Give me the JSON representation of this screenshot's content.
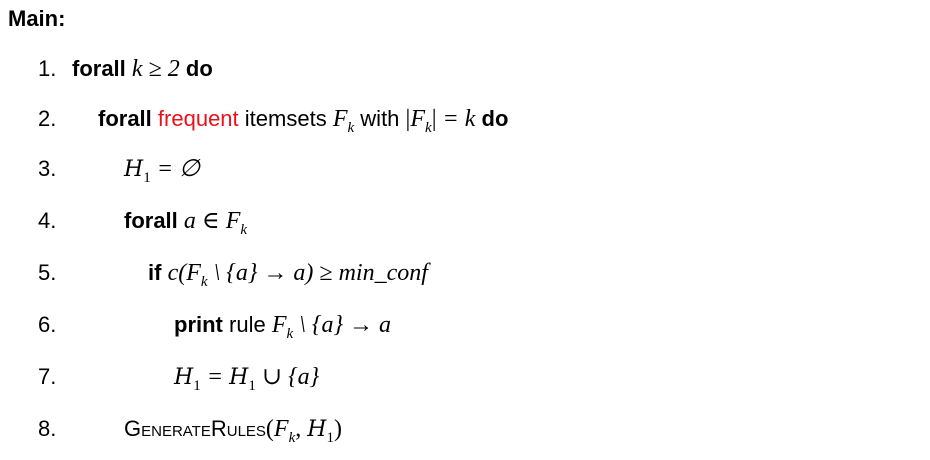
{
  "title": "Main:",
  "lines": [
    {
      "num": "1.",
      "kw1": "forall",
      "math1": "k ≥ 2",
      "kw2": "do"
    },
    {
      "num": "2.",
      "kw1": "forall",
      "red": "frequent",
      "text1": "itemsets",
      "math1": "F",
      "sub1": "k",
      "text2": "with",
      "math2": "|F",
      "sub2": "k",
      "math3": "| = k",
      "kw2": "do"
    },
    {
      "num": "3.",
      "cal": "H",
      "sub": "1",
      "math": "= ∅"
    },
    {
      "num": "4.",
      "kw1": "forall",
      "math1": "a ∈ F",
      "sub1": "k"
    },
    {
      "num": "5.",
      "kw1": "if",
      "math1": "c(F",
      "sub1": "k",
      "math2": "\\ {a} → a) ≥ min_conf"
    },
    {
      "num": "6.",
      "kw1": "print",
      "text1": "rule",
      "math1": "F",
      "sub1": "k",
      "math2": "\\ {a} → a"
    },
    {
      "num": "7.",
      "cal1": "H",
      "sub1": "1",
      "math1": "=",
      "cal2": "H",
      "sub2": "1",
      "math2": "∪ {a}"
    },
    {
      "num": "8.",
      "proc": "GenerateRules",
      "math1": "(F",
      "sub1": "k",
      "math2": ",",
      "cal": "H",
      "sub2": "1",
      "math3": ")"
    }
  ]
}
